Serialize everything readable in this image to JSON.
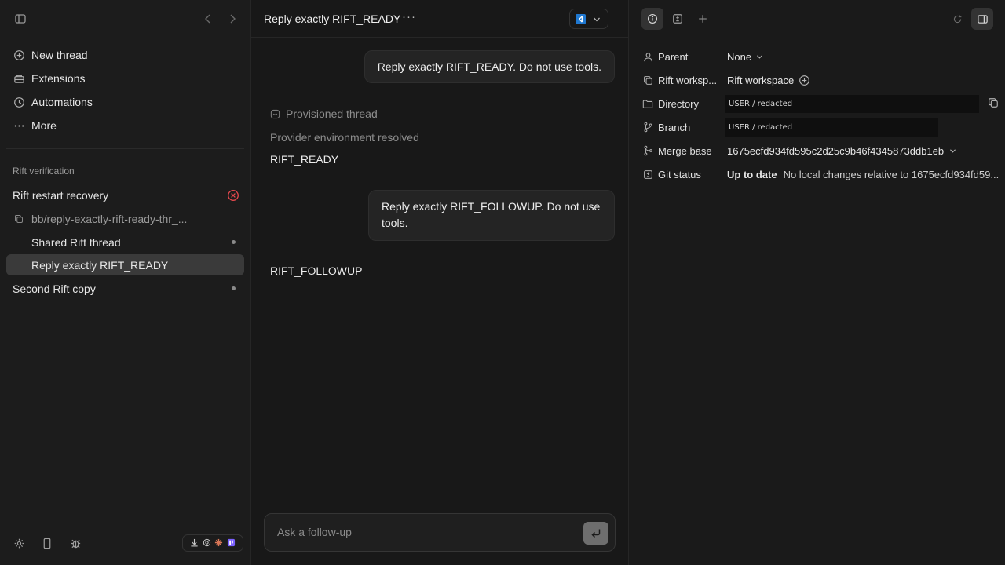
{
  "sidebar": {
    "nav": [
      {
        "label": "New thread",
        "icon": "plus-circle-icon"
      },
      {
        "label": "Extensions",
        "icon": "extensions-icon"
      },
      {
        "label": "Automations",
        "icon": "clock-icon"
      },
      {
        "label": "More",
        "icon": "more-dots-icon"
      }
    ],
    "section_label": "Rift verification",
    "items": {
      "restart": "Rift restart recovery",
      "branch": "bb/reply-exactly-rift-ready-thr_...",
      "shared": "Shared Rift thread",
      "active": "Reply exactly RIFT_READY",
      "second": "Second Rift copy"
    }
  },
  "chat": {
    "title": "Reply exactly RIFT_READY",
    "more_glyph": "···",
    "messages": {
      "user1": "Reply exactly RIFT_READY. Do not use tools.",
      "status1": "Provisioned thread",
      "status2": "Provider environment resolved",
      "reply1": "RIFT_READY",
      "user2": "Reply exactly RIFT_FOLLOWUP. Do not use tools.",
      "reply2": "RIFT_FOLLOWUP"
    },
    "composer_placeholder": "Ask a follow-up"
  },
  "panel": {
    "rows": {
      "parent": {
        "label": "Parent",
        "value": "None"
      },
      "workspace": {
        "label": "Rift worksp...",
        "value": "Rift workspace"
      },
      "directory": {
        "label": "Directory",
        "value": "USER / redacted"
      },
      "branch": {
        "label": "Branch",
        "value": "USER / redacted"
      },
      "merge": {
        "label": "Merge base",
        "value": "1675ecfd934fd595c2d25c9b46f4345873ddb1eb"
      },
      "git": {
        "label": "Git status",
        "status": "Up to date",
        "detail": "No local changes relative to 1675ecfd934fd59..."
      }
    }
  },
  "colors": {
    "background": "#181818",
    "sidebar": "#1c1c1c",
    "active_item": "#3a3a3a",
    "error": "#e5484d",
    "vscode": "#1f78d1"
  }
}
